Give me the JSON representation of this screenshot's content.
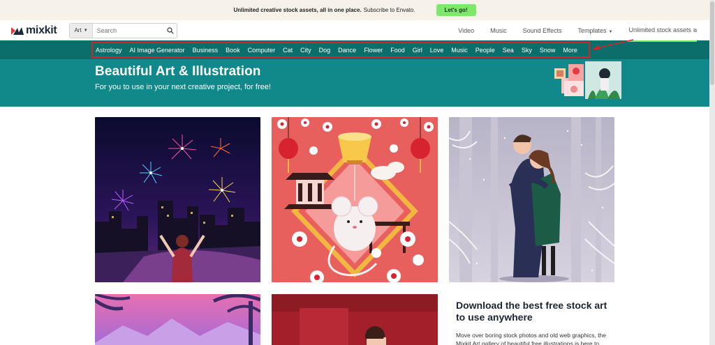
{
  "promo_bar": {
    "headline": "Unlimited creative stock assets, all in one place.",
    "subtext": "Subscribe to Envato.",
    "cta_label": "Let's go!"
  },
  "header": {
    "logo_text": "mixkit",
    "search_category": "Art",
    "search_placeholder": "Search",
    "nav": {
      "video": "Video",
      "music": "Music",
      "sound_effects": "Sound Effects",
      "templates": "Templates",
      "unlimited": "Unlimited stock assets"
    }
  },
  "categories": [
    "Astrology",
    "AI Image Generator",
    "Business",
    "Book",
    "Computer",
    "Cat",
    "City",
    "Dog",
    "Dance",
    "Flower",
    "Food",
    "Girl",
    "Love",
    "Music",
    "People",
    "Sea",
    "Sky",
    "Snow",
    "More"
  ],
  "hero": {
    "title": "Beautiful Art & Illustration",
    "subtitle": "For you to use in your next creative project, for free!"
  },
  "side_promo": {
    "heading": "Download the best free stock art to use anywhere",
    "body": "Move over boring stock photos and old web graphics, the Mixkit Art gallery of beautiful free illustrations is here to"
  },
  "colors": {
    "category_bar": "#0b6e6a",
    "hero_bg": "#11898a",
    "cta_green": "#7de86a",
    "highlight_red": "#d6222a"
  }
}
